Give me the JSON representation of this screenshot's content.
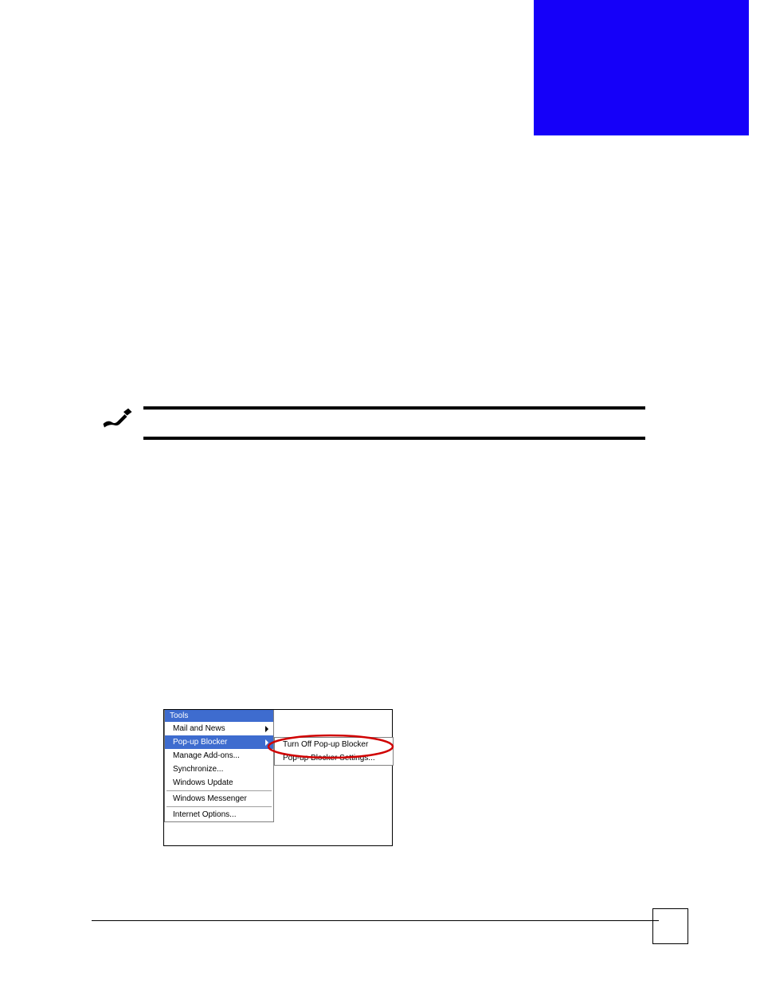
{
  "note": {
    "icon_name": "hand-writing-icon",
    "text": ""
  },
  "tools_menu": {
    "title": "Tools",
    "items": [
      {
        "label": "Mail and News",
        "has_submenu": true,
        "selected": false
      },
      {
        "label": "Pop-up Blocker",
        "has_submenu": true,
        "selected": true
      },
      {
        "label": "Manage Add-ons...",
        "has_submenu": false,
        "selected": false
      },
      {
        "label": "Synchronize...",
        "has_submenu": false,
        "selected": false
      },
      {
        "label": "Windows Update",
        "has_submenu": false,
        "selected": false
      },
      {
        "label": "Windows Messenger",
        "has_submenu": false,
        "selected": false,
        "sep_before": true
      },
      {
        "label": "Internet Options...",
        "has_submenu": false,
        "selected": false,
        "sep_before": true
      }
    ],
    "submenu": [
      {
        "label": "Turn Off Pop-up Blocker"
      },
      {
        "label": "Pop-up Blocker Settings..."
      }
    ]
  },
  "page_number": ""
}
